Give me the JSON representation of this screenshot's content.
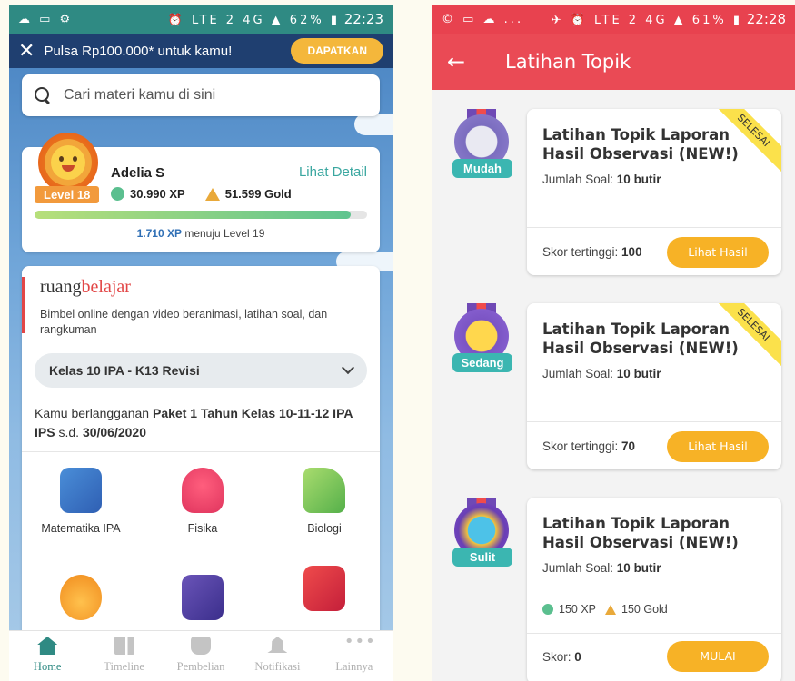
{
  "left": {
    "statusbar": {
      "icons": "☁ ▭ ⚙",
      "right_icons": "⏰ LTE 2 4G ▲ 62% ▮",
      "time": "22:23"
    },
    "promo": {
      "text": "Pulsa Rp100.000* untuk kamu!",
      "cta": "DAPATKAN"
    },
    "search": {
      "placeholder": "Cari materi kamu di sini"
    },
    "profile": {
      "name": "Adelia S",
      "level": "Level 18",
      "detail_link": "Lihat Detail",
      "xp": "30.990 XP",
      "gold": "51.599 Gold",
      "xp_progress": 0.95,
      "xp_needed": "1.710 XP",
      "xp_next_text": " menuju Level 19"
    },
    "ruangbelajar": {
      "logo_a": "ruang",
      "logo_b": "belajar",
      "description": "Bimbel online dengan video beranimasi, latihan soal, dan rangkuman",
      "selected_class": "Kelas 10 IPA - K13 Revisi",
      "sub_prefix": "Kamu berlangganan ",
      "sub_package": "Paket 1 Tahun Kelas 10-11-12 IPA IPS",
      "sub_mid": " s.d. ",
      "sub_date": "30/06/2020",
      "subjects": [
        {
          "label": "Matematika IPA",
          "icon": "calculator-icon"
        },
        {
          "label": "Fisika",
          "icon": "magnet-icon"
        },
        {
          "label": "Biologi",
          "icon": "microscope-icon"
        },
        {
          "label": "",
          "icon": "flask-icon"
        },
        {
          "label": "",
          "icon": "english-book-icon"
        },
        {
          "label": "",
          "icon": "indonesia-book-icon"
        }
      ]
    },
    "tabs": [
      {
        "label": "Home",
        "icon": "home-icon",
        "active": true
      },
      {
        "label": "Timeline",
        "icon": "timeline-icon",
        "active": false
      },
      {
        "label": "Pembelian",
        "icon": "basket-icon",
        "active": false
      },
      {
        "label": "Notifikasi",
        "icon": "bell-icon",
        "active": false
      },
      {
        "label": "Lainnya",
        "icon": "more-icon",
        "active": false
      }
    ]
  },
  "right": {
    "statusbar": {
      "icons": "© ▭ ☁ ...",
      "right_icons": "✈ ⏰ LTE 2 4G ▲ 61% ▮",
      "time": "22:28"
    },
    "appbar": {
      "title": "Latihan Topik"
    },
    "quizzes": [
      {
        "level": "Mudah",
        "title": "Latihan Topik Laporan Hasil Observasi (NEW!)",
        "count_label": "Jumlah Soal: ",
        "count": "10 butir",
        "score_label": "Skor tertinggi: ",
        "score": "100",
        "button": "Lihat Hasil",
        "ribbon": "SELESAI"
      },
      {
        "level": "Sedang",
        "title": "Latihan Topik Laporan Hasil Observasi (NEW!)",
        "count_label": "Jumlah Soal: ",
        "count": "10 butir",
        "score_label": "Skor tertinggi: ",
        "score": "70",
        "button": "Lihat Hasil",
        "ribbon": "SELESAI"
      },
      {
        "level": "Sulit",
        "title": "Latihan Topik Laporan Hasil Observasi (NEW!)",
        "count_label": "Jumlah Soal: ",
        "count": "10 butir",
        "reward_xp": "150 XP",
        "reward_gold": "150 Gold",
        "score_label": "Skor: ",
        "score": "0",
        "button": "MULAI"
      }
    ]
  },
  "colors": {
    "teal": "#2f8a83",
    "navy": "#1f3f70",
    "red": "#ea4a55",
    "amber": "#f7b226",
    "badge_teal": "#3bb6b1"
  }
}
